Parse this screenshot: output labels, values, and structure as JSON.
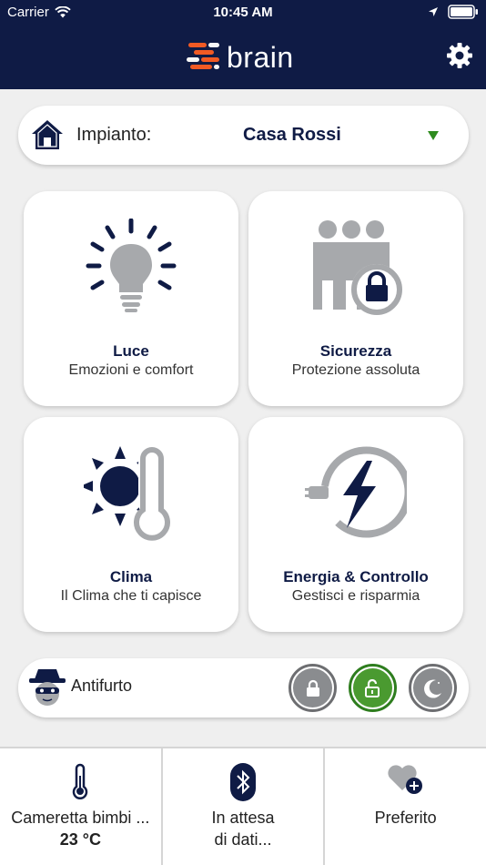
{
  "status_bar": {
    "carrier": "Carrier",
    "time": "10:45 AM"
  },
  "header": {
    "logo_text": "brain"
  },
  "plant": {
    "label": "Impianto:",
    "value": "Casa Rossi"
  },
  "cards": [
    {
      "title": "Luce",
      "subtitle": "Emozioni e comfort",
      "icon": "lightbulb-icon"
    },
    {
      "title": "Sicurezza",
      "subtitle": "Protezione assoluta",
      "icon": "security-lock-icon"
    },
    {
      "title": "Clima",
      "subtitle": "Il Clima che ti capisce",
      "icon": "sun-thermometer-icon"
    },
    {
      "title": "Energia & Controllo",
      "subtitle": "Gestisci e risparmia",
      "icon": "energy-bolt-icon"
    }
  ],
  "alarm": {
    "label": "Antifurto",
    "buttons": [
      {
        "name": "lock",
        "active": false
      },
      {
        "name": "unlock",
        "active": true
      },
      {
        "name": "night",
        "active": false
      }
    ]
  },
  "bottom_tiles": [
    {
      "line1": "Cameretta bimbi ...",
      "line2": "23 °C",
      "icon": "thermometer-icon"
    },
    {
      "line1": "In attesa",
      "line2": "di dati...",
      "icon": "bluetooth-icon"
    },
    {
      "line1": "Preferito",
      "line2": "",
      "icon": "heart-add-icon"
    }
  ],
  "colors": {
    "navy": "#0f1b45",
    "accent_orange": "#f15a24",
    "active_green": "#4a9a30",
    "gray_icon": "#a7a9ac"
  }
}
